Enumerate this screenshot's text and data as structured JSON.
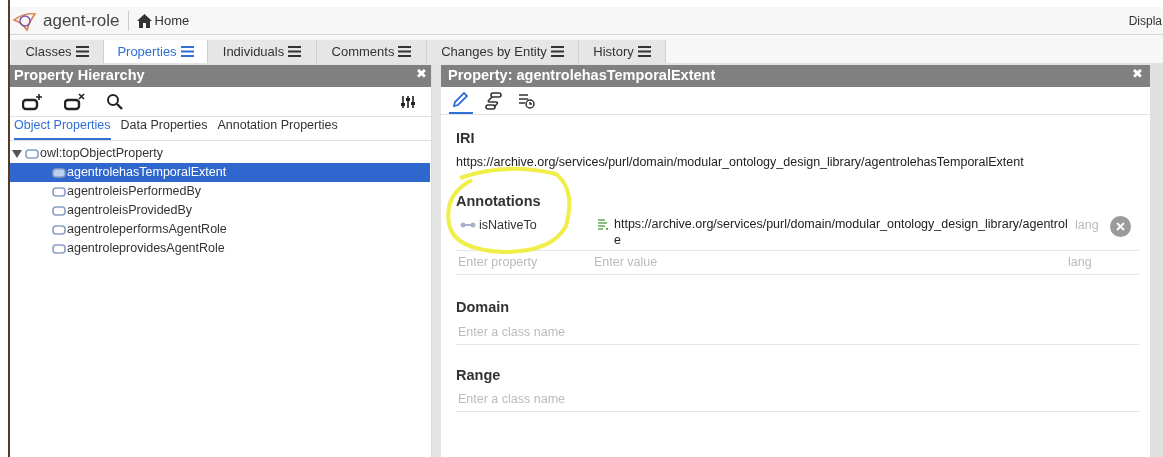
{
  "header": {
    "project": "agent-role",
    "home": "Home",
    "display": "Displa"
  },
  "tabs": [
    {
      "label": "Classes",
      "selected": false
    },
    {
      "label": "Properties",
      "selected": true
    },
    {
      "label": "Individuals",
      "selected": false
    },
    {
      "label": "Comments",
      "selected": false
    },
    {
      "label": "Changes by Entity",
      "selected": false
    },
    {
      "label": "History",
      "selected": false
    }
  ],
  "left_panel": {
    "title": "Property Hierarchy",
    "close": "✖",
    "subtabs": [
      {
        "label": "Object Properties",
        "selected": true
      },
      {
        "label": "Data Properties",
        "selected": false
      },
      {
        "label": "Annotation Properties",
        "selected": false
      }
    ],
    "tree": [
      {
        "label": "owl:topObjectProperty",
        "expanded": true,
        "selected": false,
        "children": [
          {
            "label": "agentrolehasTemporalExtent",
            "selected": true
          },
          {
            "label": "agentroleisPerformedBy",
            "selected": false
          },
          {
            "label": "agentroleisProvidedBy",
            "selected": false
          },
          {
            "label": "agentroleperformsAgentRole",
            "selected": false
          },
          {
            "label": "agentroleprovidesAgentRole",
            "selected": false
          }
        ]
      }
    ]
  },
  "right_panel": {
    "title": "Property: agentrolehasTemporalExtent",
    "close": "✖",
    "toolbar": [
      {
        "kind": "edit",
        "selected": true
      },
      {
        "kind": "graph",
        "selected": false
      },
      {
        "kind": "history",
        "selected": false
      }
    ],
    "iri_label": "IRI",
    "iri": "https://archive.org/services/purl/domain/modular_ontology_design_library/agentrolehasTemporalExtent",
    "annotations_label": "Annotations",
    "annotations": [
      {
        "property": "isNativeTo",
        "value": "https://archive.org/services/purl/domain/modular_ontology_design_library/agentrole",
        "lang": "lang"
      }
    ],
    "new_annotation": {
      "property_placeholder": "Enter property",
      "value_placeholder": "Enter value",
      "lang_placeholder": "lang"
    },
    "domain_label": "Domain",
    "domain_placeholder": "Enter a class name",
    "range_label": "Range",
    "range_placeholder": "Enter a class name"
  }
}
